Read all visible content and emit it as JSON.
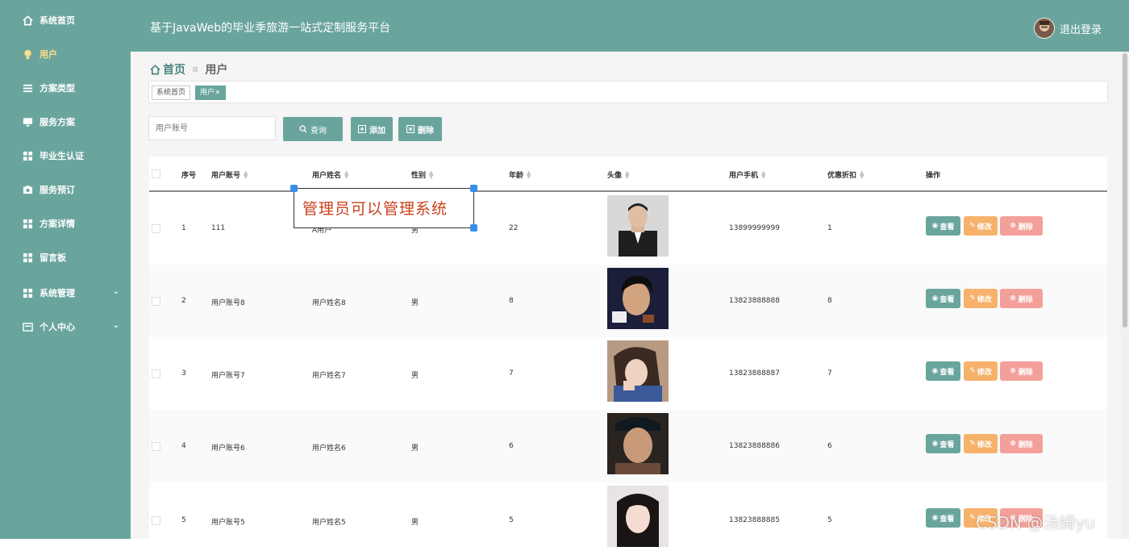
{
  "app": {
    "title": "基于JavaWeb的毕业季旅游一站式定制服务平台",
    "logout": "退出登录"
  },
  "sidebar": {
    "items": [
      {
        "label": "系统首页"
      },
      {
        "label": "用户"
      },
      {
        "label": "方案类型"
      },
      {
        "label": "服务方案"
      },
      {
        "label": "毕业生认证"
      },
      {
        "label": "服务预订"
      },
      {
        "label": "方案详情"
      },
      {
        "label": "留言板"
      },
      {
        "label": "系统管理"
      },
      {
        "label": "个人中心"
      }
    ]
  },
  "breadcrumb": {
    "home": "首页",
    "current": "用户"
  },
  "tags": {
    "home": "系统首页",
    "user": "用户"
  },
  "search": {
    "placeholder": "用户账号",
    "query_label": "查询",
    "add_label": "添加",
    "delete_label": "删除"
  },
  "table": {
    "headers": {
      "index": "序号",
      "account": "用户账号",
      "name": "用户姓名",
      "gender": "性别",
      "age": "年龄",
      "avatar": "头像",
      "phone": "用户手机",
      "discount": "优惠折扣",
      "ops": "操作"
    },
    "actions": {
      "view": "查看",
      "edit": "修改",
      "delete": "删除"
    },
    "rows": [
      {
        "index": "1",
        "account": "111",
        "name": "A用户",
        "gender": "男",
        "age": "22",
        "phone": "13899999999",
        "discount": "1"
      },
      {
        "index": "2",
        "account": "用户账号8",
        "name": "用户姓名8",
        "gender": "男",
        "age": "8",
        "phone": "13823888888",
        "discount": "8"
      },
      {
        "index": "3",
        "account": "用户账号7",
        "name": "用户姓名7",
        "gender": "男",
        "age": "7",
        "phone": "13823888887",
        "discount": "7"
      },
      {
        "index": "4",
        "account": "用户账号6",
        "name": "用户姓名6",
        "gender": "男",
        "age": "6",
        "phone": "13823888886",
        "discount": "6"
      },
      {
        "index": "5",
        "account": "用户账号5",
        "name": "用户姓名5",
        "gender": "男",
        "age": "5",
        "phone": "13823888885",
        "discount": "5"
      }
    ]
  },
  "overlay": {
    "text": "管理员可以管理系统"
  },
  "watermark": "CSDN @汤姆yu",
  "colors": {
    "accent": "#6aa59d",
    "edit": "#f6b26b",
    "delete": "#f4a09a"
  }
}
